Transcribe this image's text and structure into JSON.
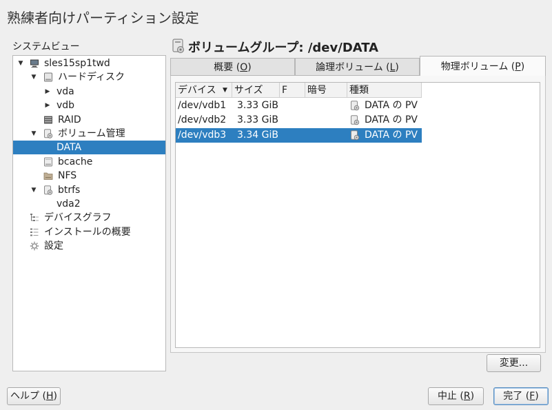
{
  "window": {
    "title": "熟練者向けパーティション設定"
  },
  "system_view": {
    "label": "システムビュー",
    "tree": [
      {
        "label": "sles15sp1twd",
        "icon": "computer-icon",
        "level": 0,
        "arrow": "down"
      },
      {
        "label": "ハードディスク",
        "icon": "harddisk-icon",
        "level": 1,
        "arrow": "down"
      },
      {
        "label": "vda",
        "icon": "",
        "level": 2,
        "arrow": "right"
      },
      {
        "label": "vdb",
        "icon": "",
        "level": 2,
        "arrow": "right"
      },
      {
        "label": "RAID",
        "icon": "raid-icon",
        "level": 1,
        "arrow": ""
      },
      {
        "label": "ボリューム管理",
        "icon": "volume-manager-icon",
        "level": 1,
        "arrow": "down"
      },
      {
        "label": "DATA",
        "icon": "",
        "level": 2,
        "arrow": "",
        "selected": true
      },
      {
        "label": "bcache",
        "icon": "bcache-icon",
        "level": 1,
        "arrow": ""
      },
      {
        "label": "NFS",
        "icon": "nfs-folder-icon",
        "level": 1,
        "arrow": ""
      },
      {
        "label": "btrfs",
        "icon": "btrfs-icon",
        "level": 1,
        "arrow": "down"
      },
      {
        "label": "vda2",
        "icon": "",
        "level": 2,
        "arrow": ""
      },
      {
        "label": "デバイスグラフ",
        "icon": "device-graph-icon",
        "level": 0,
        "arrow": ""
      },
      {
        "label": "インストールの概要",
        "icon": "install-summary-icon",
        "level": 0,
        "arrow": ""
      },
      {
        "label": "設定",
        "icon": "settings-gear-icon",
        "level": 0,
        "arrow": ""
      }
    ]
  },
  "volume_group": {
    "title": "ボリュームグループ: /dev/DATA"
  },
  "tabs": [
    {
      "label": "概要 (O)",
      "active": false
    },
    {
      "label": "論理ボリューム (L)",
      "active": false
    },
    {
      "label": "物理ボリューム (P)",
      "active": true
    }
  ],
  "table": {
    "columns": [
      "デバイス",
      "サイズ",
      "F",
      "暗号",
      "種類"
    ],
    "rows": [
      {
        "device": "/dev/vdb1",
        "size": "3.33 GiB",
        "f": "",
        "enc": "",
        "type": "DATA の PV",
        "selected": false
      },
      {
        "device": "/dev/vdb2",
        "size": "3.33 GiB",
        "f": "",
        "enc": "",
        "type": "DATA の PV",
        "selected": false
      },
      {
        "device": "/dev/vdb3",
        "size": "3.34 GiB",
        "f": "",
        "enc": "",
        "type": "DATA の PV",
        "selected": true
      }
    ]
  },
  "buttons": {
    "change": "変更...",
    "help": "ヘルプ (H)",
    "abort": "中止 (R)",
    "finish": "完了 (F)"
  },
  "colors": {
    "selection": "#2d7fc0"
  }
}
